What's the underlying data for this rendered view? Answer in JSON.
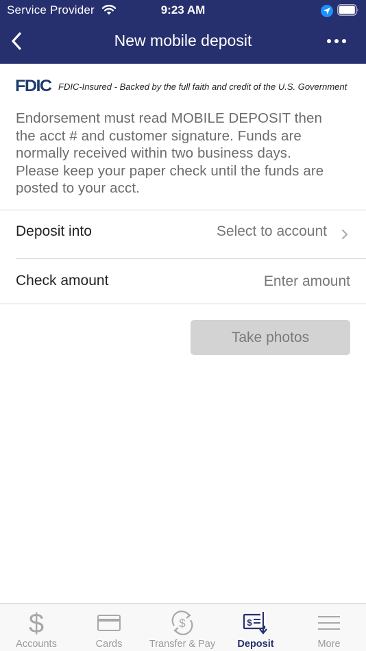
{
  "status_bar": {
    "carrier": "Service Provider",
    "time": "9:23 AM"
  },
  "header": {
    "title": "New mobile deposit"
  },
  "fdic": {
    "logo": "FDIC",
    "text": "FDIC-Insured - Backed by the full faith and credit of the U.S. Government"
  },
  "notice": {
    "lines": [
      "Endorsement must read MOBILE DEPOSIT then",
      "the acct # and customer signature. Funds are",
      "normally received within two business days.",
      "Please keep your paper check until the funds are",
      "posted to your acct."
    ]
  },
  "form": {
    "deposit_into": {
      "label": "Deposit into",
      "value": "Select to account"
    },
    "check_amount": {
      "label": "Check amount",
      "placeholder": "Enter amount"
    }
  },
  "actions": {
    "take_photos": "Take photos"
  },
  "tabbar": {
    "tabs": [
      {
        "label": "Accounts",
        "icon": "dollar-icon"
      },
      {
        "label": "Cards",
        "icon": "card-icon"
      },
      {
        "label": "Transfer & Pay",
        "icon": "transfer-icon"
      },
      {
        "label": "Deposit",
        "icon": "deposit-icon",
        "active": true
      },
      {
        "label": "More",
        "icon": "menu-icon"
      }
    ]
  },
  "colors": {
    "header_bg": "#26306e",
    "active_tab": "#26306e",
    "disabled_button": "#d3d3d3"
  }
}
